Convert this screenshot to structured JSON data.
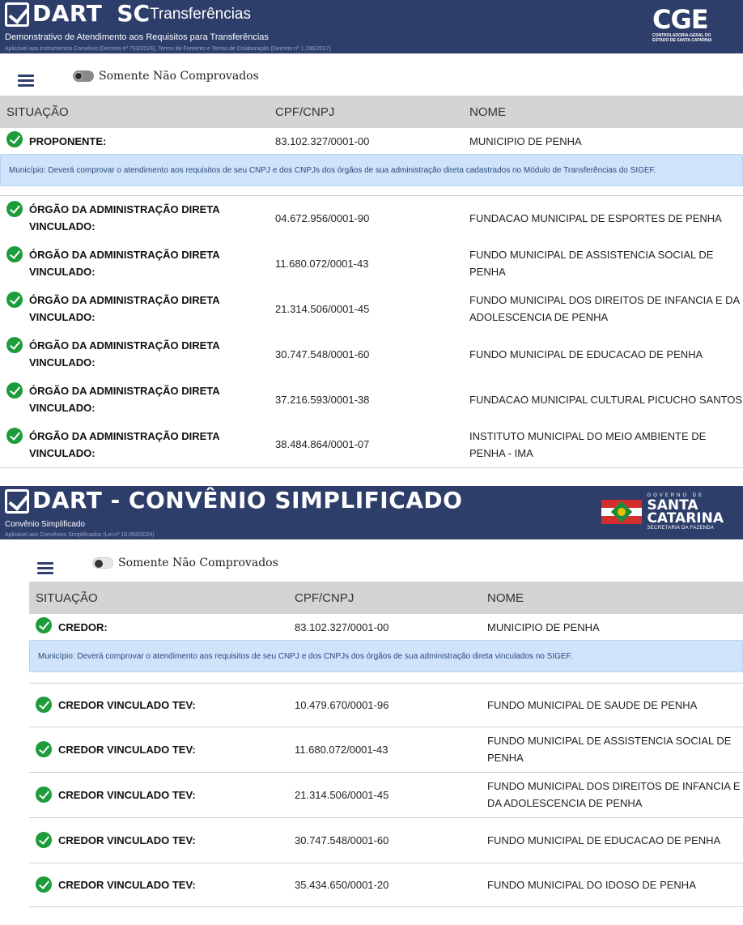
{
  "panel1": {
    "banner": {
      "title_main": "DART",
      "title_sc": "SC",
      "title_sub": "Transferências",
      "subtitle": "Demonstrativo de Atendimento aos Requisitos para Transferências",
      "note": "Aplicável aos instrumentos Convênio (Decreto nº 733/2024), Termo de Fomento e Termo de Colaboração (Decreto nº 1.196/2017)",
      "logo_letters": "CGE",
      "logo_sub1": "CONTROLADORIA-GERAL DO",
      "logo_sub2": "ESTADO DE SANTA CATARINA"
    },
    "toggle_label": "Somente Não Comprovados",
    "columns": [
      "SITUAÇÃO",
      "CPF/CNPJ",
      "NOME"
    ],
    "main_row": {
      "situacao": "PROPONENTE:",
      "cnpj": "83.102.327/0001-00",
      "nome": "MUNICIPIO DE PENHA"
    },
    "info": "Município: Deverá comprovar o atendimento aos requisitos de seu CNPJ e dos CNPJs dos órgãos de sua administração direta cadastrados no Módulo de Transferências do SIGEF.",
    "rows": [
      {
        "situacao": "ÓRGÃO DA ADMINISTRAÇÃO DIRETA VINCULADO:",
        "cnpj": "04.672.956/0001-90",
        "nome": "FUNDACAO MUNICIPAL DE ESPORTES DE PENHA"
      },
      {
        "situacao": "ÓRGÃO DA ADMINISTRAÇÃO DIRETA VINCULADO:",
        "cnpj": "11.680.072/0001-43",
        "nome": "FUNDO MUNICIPAL DE ASSISTENCIA SOCIAL DE PENHA"
      },
      {
        "situacao": "ÓRGÃO DA ADMINISTRAÇÃO DIRETA VINCULADO:",
        "cnpj": "21.314.506/0001-45",
        "nome": "FUNDO MUNICIPAL DOS DIREITOS DE INFANCIA E DA ADOLESCENCIA DE PENHA"
      },
      {
        "situacao": "ÓRGÃO DA ADMINISTRAÇÃO DIRETA VINCULADO:",
        "cnpj": "30.747.548/0001-60",
        "nome": "FUNDO MUNICIPAL DE EDUCACAO DE PENHA"
      },
      {
        "situacao": "ÓRGÃO DA ADMINISTRAÇÃO DIRETA VINCULADO:",
        "cnpj": "37.216.593/0001-38",
        "nome": "FUNDACAO MUNICIPAL CULTURAL PICUCHO SANTOS"
      },
      {
        "situacao": "ÓRGÃO DA ADMINISTRAÇÃO DIRETA VINCULADO:",
        "cnpj": "38.484.864/0001-07",
        "nome": "INSTITUTO MUNICIPAL DO MEIO AMBIENTE DE PENHA - IMA"
      }
    ]
  },
  "panel2": {
    "banner": {
      "title_main": "DART - CONVÊNIO SIMPLIFICADO",
      "subtitle": "Convênio Simplificado",
      "note": "Aplicável aos Convênios Simplificados (Lei nº 19.093/2024)",
      "logo_gov": "GOVERNO DE",
      "logo_line1": "SANTA",
      "logo_line2": "CATARINA",
      "logo_sec": "SECRETARIA DA FAZENDA"
    },
    "toggle_label": "Somente Não Comprovados",
    "columns": [
      "SITUAÇÃO",
      "CPF/CNPJ",
      "NOME"
    ],
    "main_row": {
      "situacao": "CREDOR:",
      "cnpj": "83.102.327/0001-00",
      "nome": "MUNICIPIO DE PENHA"
    },
    "info": "Município: Deverá comprovar o atendimento aos requisitos de seu CNPJ e dos CNPJs dos órgãos de sua administração direta vinculados no SIGEF.",
    "rows": [
      {
        "situacao": "CREDOR VINCULADO TEV:",
        "cnpj": "10.479.670/0001-96",
        "nome": "FUNDO MUNICIPAL DE SAUDE DE PENHA"
      },
      {
        "situacao": "CREDOR VINCULADO TEV:",
        "cnpj": "11.680.072/0001-43",
        "nome": "FUNDO MUNICIPAL DE ASSISTENCIA SOCIAL DE PENHA"
      },
      {
        "situacao": "CREDOR VINCULADO TEV:",
        "cnpj": "21.314.506/0001-45",
        "nome": "FUNDO MUNICIPAL DOS DIREITOS DE INFANCIA E DA ADOLESCENCIA DE PENHA"
      },
      {
        "situacao": "CREDOR VINCULADO TEV:",
        "cnpj": "30.747.548/0001-60",
        "nome": "FUNDO MUNICIPAL DE EDUCACAO DE PENHA"
      },
      {
        "situacao": "CREDOR VINCULADO TEV:",
        "cnpj": "35.434.650/0001-20",
        "nome": "FUNDO MUNICIPAL DO IDOSO DE PENHA"
      }
    ]
  },
  "colors": {
    "banner": "#2e3e6a",
    "success": "#1e9b3a",
    "info_bg": "#cfe3fb",
    "header_bg": "#d4d4d4"
  },
  "icons": {
    "check": "check-circle-icon",
    "menu": "hamburger-menu-icon",
    "logo_check": "checkbox-logo-icon"
  }
}
